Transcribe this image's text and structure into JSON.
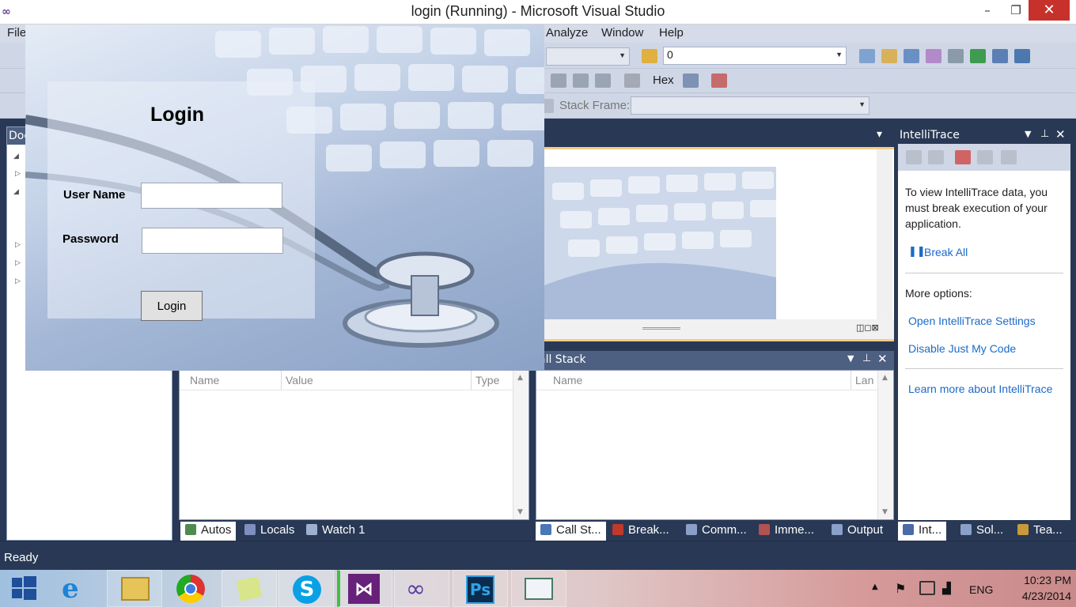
{
  "window": {
    "title": "login (Running) - Microsoft Visual Studio",
    "minimize": "–",
    "maximize": "❐",
    "close": "✕"
  },
  "menu": {
    "file": "File",
    "analyze": "Analyze",
    "window": "Window",
    "help": "Help"
  },
  "toolbar": {
    "combo_value": "0",
    "hex_label": "Hex",
    "stack_frame_label": "Stack Frame:",
    "stack_frame_value": ""
  },
  "left_panel": {
    "title": "Doc"
  },
  "designer": {
    "dropdown": "▾"
  },
  "autos": {
    "columns": [
      "Name",
      "Value",
      "Type"
    ]
  },
  "call_stack": {
    "title": "all Stack",
    "columns": [
      "Name",
      "Lan"
    ]
  },
  "bottom_tabs_left": [
    {
      "label": "Autos",
      "active": true
    },
    {
      "label": "Locals",
      "active": false
    },
    {
      "label": "Watch 1",
      "active": false
    }
  ],
  "bottom_tabs_mid": [
    {
      "label": "Call St...",
      "active": true
    },
    {
      "label": "Break...",
      "active": false
    },
    {
      "label": "Comm...",
      "active": false
    },
    {
      "label": "Imme...",
      "active": false
    },
    {
      "label": "Output",
      "active": false
    }
  ],
  "bottom_tabs_right": [
    {
      "label": "Int...",
      "active": true
    },
    {
      "label": "Sol...",
      "active": false
    },
    {
      "label": "Tea...",
      "active": false
    }
  ],
  "intellitrace": {
    "title": "IntelliTrace",
    "message": "To view IntelliTrace data, you must break execution of your application.",
    "break_all": "Break All",
    "more_options": "More options:",
    "open_settings": "Open IntelliTrace Settings",
    "disable_jmc": "Disable Just My Code",
    "learn_more": "Learn more about IntelliTrace"
  },
  "status": {
    "text": "Ready"
  },
  "login_form": {
    "title": "Login",
    "username_label": "User Name",
    "username_value": "",
    "password_label": "Password",
    "password_value": "",
    "button_label": "Login"
  },
  "taskbar": {
    "apps": [
      "start",
      "internet-explorer",
      "file-explorer",
      "chrome",
      "sticky-notes",
      "skype",
      "visual-studio",
      "infinity-app",
      "photoshop",
      "form-app"
    ],
    "language": "ENG",
    "time": "10:23 PM",
    "date": "4/23/2014"
  },
  "colors": {
    "accent": "#293955",
    "link": "#1b6ac7",
    "highlight": "#f5cc84",
    "close_red": "#c7312b"
  }
}
